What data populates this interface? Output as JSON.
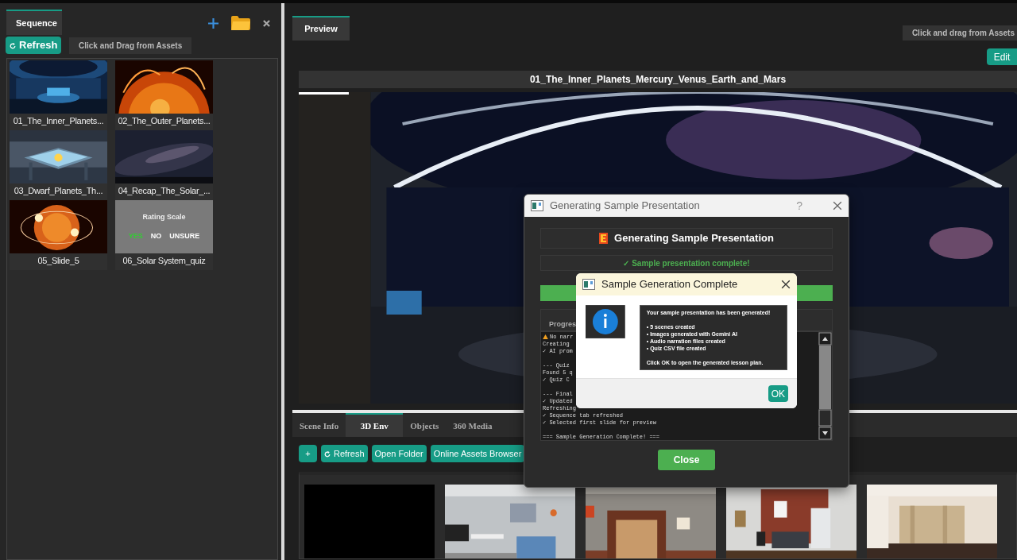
{
  "sequence_panel": {
    "tabs": [
      {
        "label": "Sequence",
        "selected": true
      }
    ],
    "refresh_button": "Refresh",
    "hint": "Click and Drag from Assets",
    "items": [
      {
        "kind": "picture",
        "caption": "01_The_Inner_Planets..."
      },
      {
        "kind": "picture",
        "caption": "02_The_Outer_Planets..."
      },
      {
        "kind": "picture",
        "caption": "03_Dwarf_Planets_Th..."
      },
      {
        "kind": "picture",
        "caption": "04_Recap_The_Solar_..."
      },
      {
        "kind": "picture",
        "caption": "05_Slide_5"
      },
      {
        "kind": "quiz",
        "caption": "06_Solar System_quiz"
      }
    ],
    "quiz_slide": {
      "title": "Rating Scale",
      "options": [
        {
          "label": "YES",
          "color": "#33cc33"
        },
        {
          "label": "NO",
          "color": "#ffffff"
        },
        {
          "label": "UNSURE",
          "color": "#ffffff"
        }
      ]
    }
  },
  "preview_panel": {
    "tabs": [
      {
        "label": "Preview",
        "selected": true
      }
    ],
    "hint": "Click and drag from Assets",
    "edit_button": "Edit",
    "slide_title": "01_The_Inner_Planets_Mercury_Venus_Earth_and_Mars",
    "playback": {
      "level": 0.07
    },
    "editor_tabs": [
      {
        "label": "Scene Info",
        "selected": false
      },
      {
        "label": "3D Env",
        "selected": true
      },
      {
        "label": "Objects",
        "selected": false
      },
      {
        "label": "360 Media",
        "selected": false
      }
    ],
    "toolbar": [
      {
        "kind": "add",
        "label": "+"
      },
      {
        "kind": "refresh",
        "label": "Refresh"
      },
      {
        "kind": "plain",
        "label": "Open Folder"
      },
      {
        "kind": "plain",
        "label": "Online Assets Browser"
      }
    ],
    "environments": [
      {
        "kind": "blank"
      },
      {
        "kind": "picture"
      },
      {
        "kind": "picture"
      },
      {
        "kind": "picture"
      },
      {
        "kind": "picture"
      }
    ]
  },
  "progress_dialog": {
    "title": "Generating Sample Presentation",
    "help_button": "?",
    "heading": "Generating Sample Presentation",
    "status": "✓ Sample presentation complete!",
    "progress": {
      "level": 1
    },
    "group_label": "Progres",
    "log": [
      {
        "kind": "warning",
        "text": "No narr"
      },
      {
        "kind": "text",
        "text": "Creating"
      },
      {
        "kind": "text",
        "text": "✓ AI prom"
      },
      {
        "kind": "blank"
      },
      {
        "kind": "text",
        "text": "--- Quiz"
      },
      {
        "kind": "text",
        "text": "Found 5 q"
      },
      {
        "kind": "text",
        "text": "✓ Quiz C"
      },
      {
        "kind": "blank"
      },
      {
        "kind": "text",
        "text": "--- Final"
      },
      {
        "kind": "text",
        "text": "✓ Updated"
      },
      {
        "kind": "text",
        "text": "Refreshing"
      },
      {
        "kind": "text",
        "text": "✓ Sequence tab refreshed"
      },
      {
        "kind": "text",
        "text": "✓ Selected first slide for preview"
      },
      {
        "kind": "blank"
      },
      {
        "kind": "text",
        "text": "=== Sample Generation Complete! ==="
      }
    ],
    "close_button": "Close"
  },
  "info_dialog": {
    "title": "Sample Generation Complete",
    "message": [
      {
        "kind": "heading",
        "text": "Your sample presentation has been generated!"
      },
      {
        "kind": "blank"
      },
      {
        "kind": "text",
        "text": "• 5 scenes created"
      },
      {
        "kind": "text",
        "text": "• Images generated with Gemini AI"
      },
      {
        "kind": "text",
        "text": "• Audio narration files created"
      },
      {
        "kind": "text",
        "text": "• Quiz CSV file created"
      },
      {
        "kind": "blank"
      },
      {
        "kind": "text",
        "text": "Click OK to open the generated lesson plan."
      }
    ],
    "ok_button": "OK"
  }
}
